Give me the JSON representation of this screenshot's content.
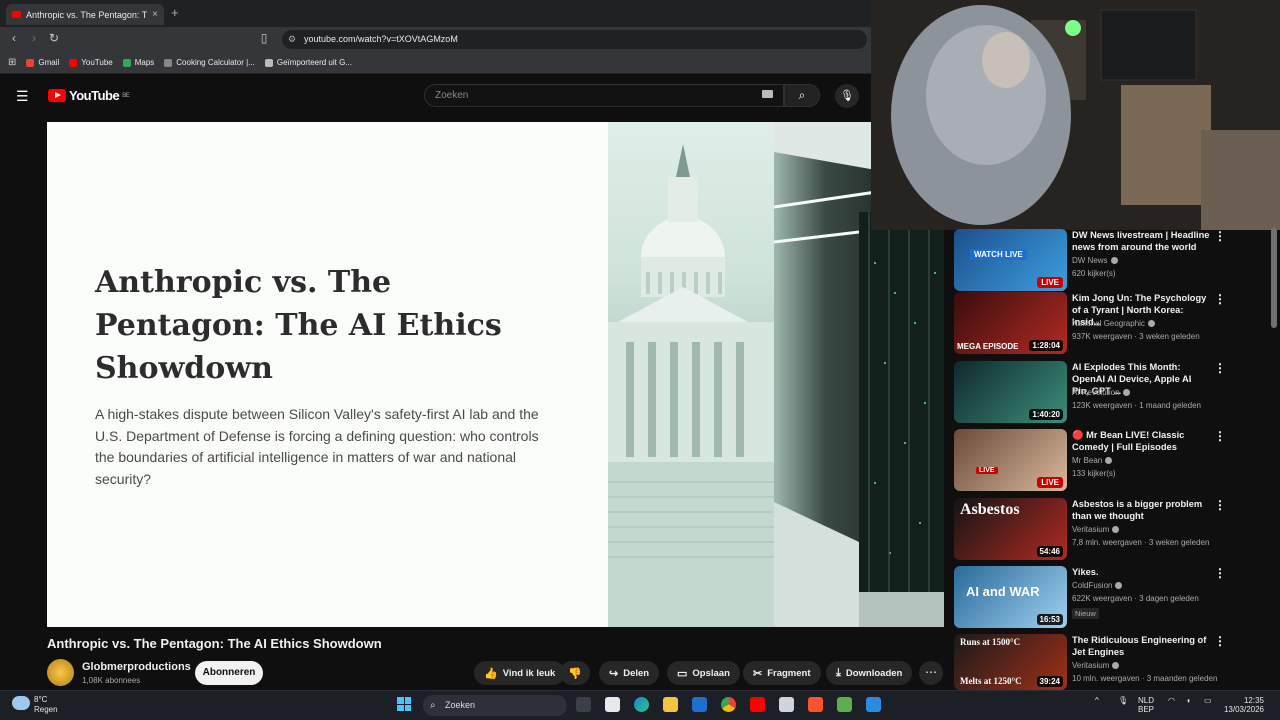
{
  "browser": {
    "tab_title": "Anthropic vs. The Pentagon: T",
    "tab_close": "×",
    "new_tab": "+",
    "url": "youtube.com/watch?v=tXOVtAGMzoM",
    "bookmarks": [
      {
        "label": "Gmail",
        "color": "#ea4335"
      },
      {
        "label": "YouTube",
        "color": "#ff0000"
      },
      {
        "label": "Maps",
        "color": "#34a853"
      },
      {
        "label": "Cooking Calculator |...",
        "color": "#888888"
      },
      {
        "label": "Geïmporteerd uit G...",
        "color": "#bbbbbb"
      }
    ]
  },
  "youtube": {
    "logo": "YouTube",
    "logo_region": "BE",
    "search_placeholder": "Zoeken"
  },
  "slide": {
    "title": "Anthropic vs. The Pentagon: The AI Ethics Showdown",
    "description": "A high-stakes dispute between Silicon Valley's safety-first AI lab and the U.S. Department of Defense is forcing a defining question: who controls the boundaries of artificial intelligence in matters of war and national security?"
  },
  "video": {
    "title": "Anthropic vs. The Pentagon: The AI Ethics Showdown",
    "channel": "Globmerproductions",
    "subscribers": "1,08K abonnees",
    "subscribe_label": "Abonneren",
    "actions": {
      "like": "Vind ik leuk",
      "share": "Delen",
      "save": "Opslaan",
      "clip": "Fragment",
      "download": "Downloaden",
      "more": "⋯"
    }
  },
  "recommendations": [
    {
      "title": "DW News livestream | Headline news from around the world",
      "channel": "DW News",
      "meta": "620 kijker(s)",
      "badge": "LIVE",
      "overlay": "WATCH LIVE",
      "thumb_color": "#1d4f8c",
      "thumb_color2": "#3c9fe0"
    },
    {
      "title": "Kim Jong Un: The Psychology of a Tyrant | North Korea: Insid...",
      "channel": "National Geographic",
      "meta": "937K weergaven · 3 weken geleden",
      "duration": "1:28:04",
      "overlay": "MEGA EPISODE",
      "thumb_color": "#3a0d0d",
      "thumb_color2": "#b22a22"
    },
    {
      "title": "AI Explodes This Month: OpenAI AI Device, Apple AI Pin, GPT ...",
      "channel": "AI Revolution",
      "meta": "123K weergaven · 1 maand geleden",
      "duration": "1:40:20",
      "thumb_color": "#10282e",
      "thumb_color2": "#3c8f7a"
    },
    {
      "title": "🔴 Mr Bean LIVE! Classic Comedy | Full Episodes",
      "channel": "Mr Bean",
      "meta": "133 kijker(s)",
      "badge": "LIVE",
      "overlay": "LIVE",
      "thumb_color": "#6b4a3a",
      "thumb_color2": "#d9b89c"
    },
    {
      "title": "Asbestos is a bigger problem than we thought",
      "channel": "Veritasium",
      "meta": "7,8 mln. weergaven · 3 weken geleden",
      "duration": "54:46",
      "overlay": "Asbestos",
      "thumb_color": "#141414",
      "thumb_color2": "#b02a22"
    },
    {
      "title": "Yikes.",
      "channel": "ColdFusion",
      "meta": "622K weergaven · 3 dagen geleden",
      "tag": "Nieuw",
      "duration": "16:53",
      "overlay": "AI and WAR",
      "thumb_color": "#2a6a9a",
      "thumb_color2": "#9fd0ef"
    },
    {
      "title": "The Ridiculous Engineering of Jet Engines",
      "channel": "Veritasium",
      "meta": "10 mln. weergaven · 3 maanden geleden",
      "duration": "39:24",
      "overlay": "Runs at 1500°C",
      "overlay2": "Melts at 1250°C",
      "thumb_color": "#1a1a1a",
      "thumb_color2": "#a03018"
    }
  ],
  "taskbar": {
    "temperature": "8°C",
    "weather": "Regen",
    "search": "Zoeken",
    "lang1": "NLD",
    "lang2": "BEP",
    "time": "12:35",
    "date": "13/03/2026"
  }
}
